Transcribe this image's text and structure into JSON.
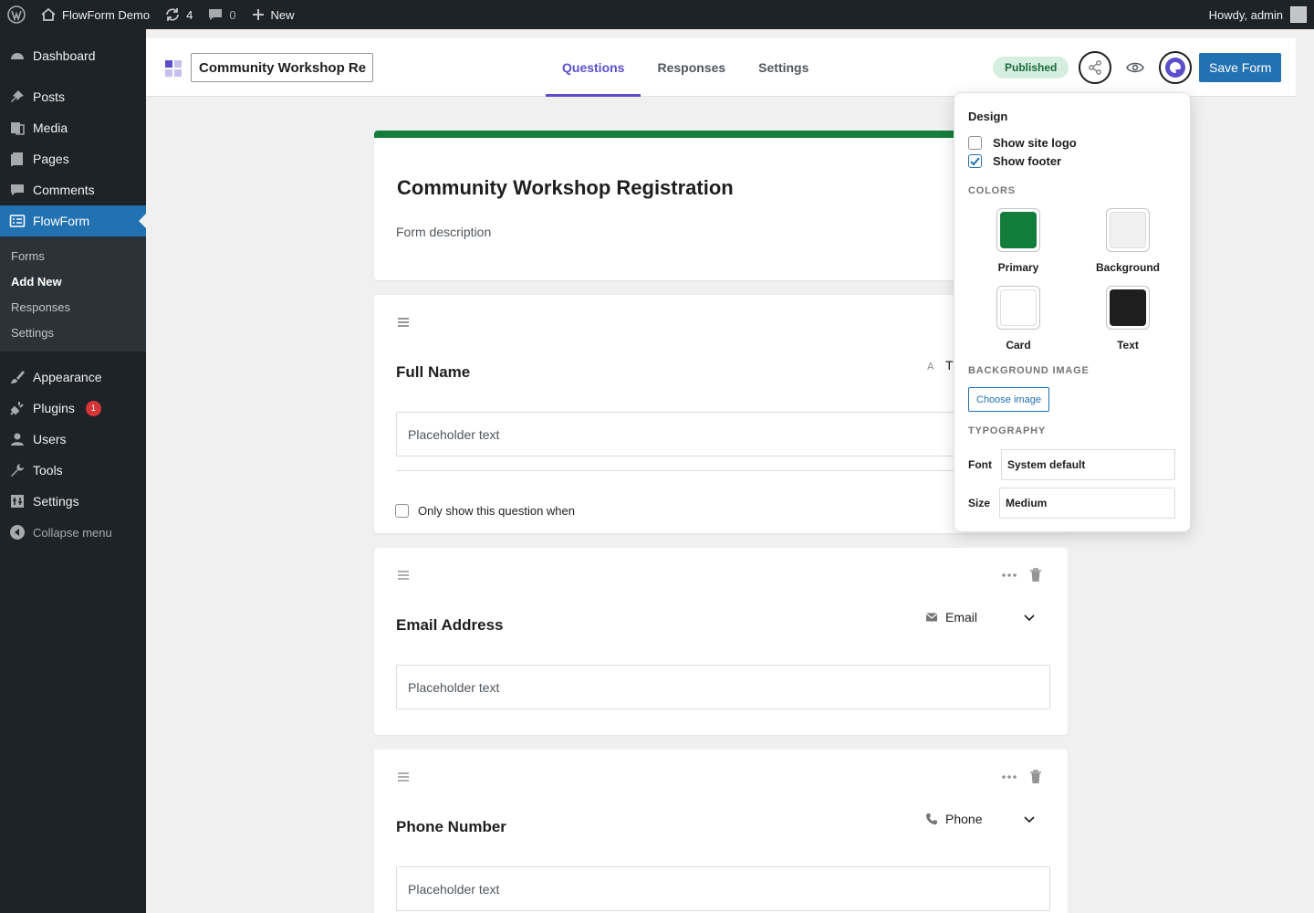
{
  "adminbar": {
    "site_name": "FlowForm Demo",
    "updates_count": "4",
    "comments_count": "0",
    "new_label": "New",
    "greeting": "Howdy, admin"
  },
  "sidebar": {
    "items": [
      {
        "label": "Dashboard",
        "icon": "dashboard-icon"
      },
      {
        "label": "Posts",
        "icon": "pin-icon"
      },
      {
        "label": "Media",
        "icon": "media-icon"
      },
      {
        "label": "Pages",
        "icon": "pages-icon"
      },
      {
        "label": "Comments",
        "icon": "comment-icon"
      },
      {
        "label": "FlowForm",
        "icon": "form-icon"
      },
      {
        "label": "Appearance",
        "icon": "brush-icon"
      },
      {
        "label": "Plugins",
        "icon": "plug-icon",
        "badge": "1"
      },
      {
        "label": "Users",
        "icon": "user-icon"
      },
      {
        "label": "Tools",
        "icon": "wrench-icon"
      },
      {
        "label": "Settings",
        "icon": "settings-icon"
      }
    ],
    "submenu": [
      "Forms",
      "Add New",
      "Responses",
      "Settings"
    ],
    "collapse_label": "Collapse menu"
  },
  "header": {
    "form_name_value": "Community Workshop Re",
    "tabs": [
      "Questions",
      "Responses",
      "Settings"
    ],
    "status_badge": "Published",
    "save_label": "Save Form"
  },
  "form": {
    "title": "Community Workshop Registration",
    "description": "Form description",
    "questions": [
      {
        "title": "Full Name",
        "type": "T",
        "type_icon": "text-icon",
        "placeholder": "Placeholder text",
        "condition_label": "Only show this question when"
      },
      {
        "title": "Email Address",
        "type": "Email",
        "type_icon": "envelope-icon",
        "placeholder": "Placeholder text"
      },
      {
        "title": "Phone Number",
        "type": "Phone",
        "type_icon": "phone-icon",
        "placeholder": "Placeholder text"
      }
    ]
  },
  "design_panel": {
    "title": "Design",
    "show_site_logo_label": "Show site logo",
    "show_site_logo_checked": false,
    "show_footer_label": "Show footer",
    "show_footer_checked": true,
    "colors_heading": "Colors",
    "colors": [
      {
        "label": "Primary",
        "value": "#137e3b"
      },
      {
        "label": "Background",
        "value": "#f0f0f0"
      },
      {
        "label": "Card",
        "value": "#ffffff"
      },
      {
        "label": "Text",
        "value": "#1e1e1e"
      }
    ],
    "background_image_heading": "Background image",
    "choose_image_label": "Choose image",
    "typography_heading": "Typography",
    "font_label": "Font",
    "font_value": "System default",
    "size_label": "Size",
    "size_value": "Medium"
  }
}
